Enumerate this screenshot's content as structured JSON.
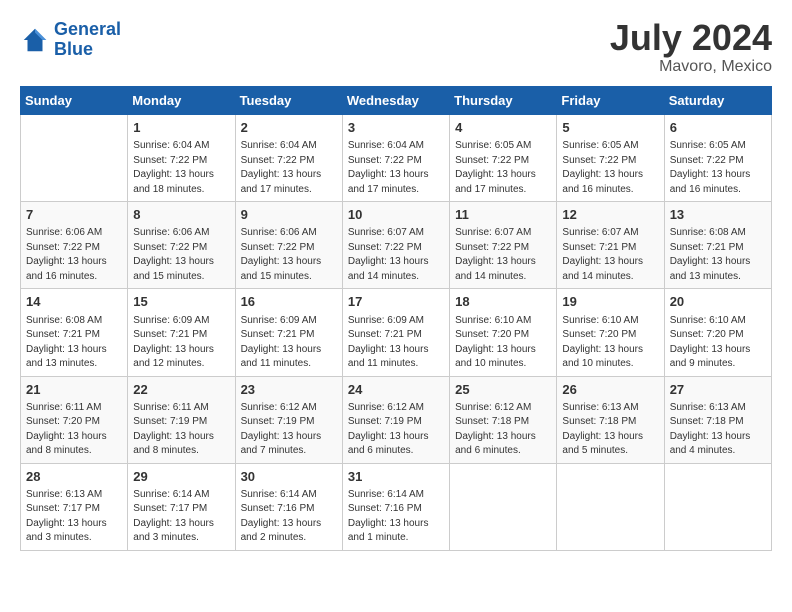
{
  "header": {
    "logo_line1": "General",
    "logo_line2": "Blue",
    "month_year": "July 2024",
    "location": "Mavoro, Mexico"
  },
  "columns": [
    "Sunday",
    "Monday",
    "Tuesday",
    "Wednesday",
    "Thursday",
    "Friday",
    "Saturday"
  ],
  "weeks": [
    [
      {
        "day": "",
        "sunrise": "",
        "sunset": "",
        "daylight": ""
      },
      {
        "day": "1",
        "sunrise": "Sunrise: 6:04 AM",
        "sunset": "Sunset: 7:22 PM",
        "daylight": "Daylight: 13 hours and 18 minutes."
      },
      {
        "day": "2",
        "sunrise": "Sunrise: 6:04 AM",
        "sunset": "Sunset: 7:22 PM",
        "daylight": "Daylight: 13 hours and 17 minutes."
      },
      {
        "day": "3",
        "sunrise": "Sunrise: 6:04 AM",
        "sunset": "Sunset: 7:22 PM",
        "daylight": "Daylight: 13 hours and 17 minutes."
      },
      {
        "day": "4",
        "sunrise": "Sunrise: 6:05 AM",
        "sunset": "Sunset: 7:22 PM",
        "daylight": "Daylight: 13 hours and 17 minutes."
      },
      {
        "day": "5",
        "sunrise": "Sunrise: 6:05 AM",
        "sunset": "Sunset: 7:22 PM",
        "daylight": "Daylight: 13 hours and 16 minutes."
      },
      {
        "day": "6",
        "sunrise": "Sunrise: 6:05 AM",
        "sunset": "Sunset: 7:22 PM",
        "daylight": "Daylight: 13 hours and 16 minutes."
      }
    ],
    [
      {
        "day": "7",
        "sunrise": "Sunrise: 6:06 AM",
        "sunset": "Sunset: 7:22 PM",
        "daylight": "Daylight: 13 hours and 16 minutes."
      },
      {
        "day": "8",
        "sunrise": "Sunrise: 6:06 AM",
        "sunset": "Sunset: 7:22 PM",
        "daylight": "Daylight: 13 hours and 15 minutes."
      },
      {
        "day": "9",
        "sunrise": "Sunrise: 6:06 AM",
        "sunset": "Sunset: 7:22 PM",
        "daylight": "Daylight: 13 hours and 15 minutes."
      },
      {
        "day": "10",
        "sunrise": "Sunrise: 6:07 AM",
        "sunset": "Sunset: 7:22 PM",
        "daylight": "Daylight: 13 hours and 14 minutes."
      },
      {
        "day": "11",
        "sunrise": "Sunrise: 6:07 AM",
        "sunset": "Sunset: 7:22 PM",
        "daylight": "Daylight: 13 hours and 14 minutes."
      },
      {
        "day": "12",
        "sunrise": "Sunrise: 6:07 AM",
        "sunset": "Sunset: 7:21 PM",
        "daylight": "Daylight: 13 hours and 14 minutes."
      },
      {
        "day": "13",
        "sunrise": "Sunrise: 6:08 AM",
        "sunset": "Sunset: 7:21 PM",
        "daylight": "Daylight: 13 hours and 13 minutes."
      }
    ],
    [
      {
        "day": "14",
        "sunrise": "Sunrise: 6:08 AM",
        "sunset": "Sunset: 7:21 PM",
        "daylight": "Daylight: 13 hours and 13 minutes."
      },
      {
        "day": "15",
        "sunrise": "Sunrise: 6:09 AM",
        "sunset": "Sunset: 7:21 PM",
        "daylight": "Daylight: 13 hours and 12 minutes."
      },
      {
        "day": "16",
        "sunrise": "Sunrise: 6:09 AM",
        "sunset": "Sunset: 7:21 PM",
        "daylight": "Daylight: 13 hours and 11 minutes."
      },
      {
        "day": "17",
        "sunrise": "Sunrise: 6:09 AM",
        "sunset": "Sunset: 7:21 PM",
        "daylight": "Daylight: 13 hours and 11 minutes."
      },
      {
        "day": "18",
        "sunrise": "Sunrise: 6:10 AM",
        "sunset": "Sunset: 7:20 PM",
        "daylight": "Daylight: 13 hours and 10 minutes."
      },
      {
        "day": "19",
        "sunrise": "Sunrise: 6:10 AM",
        "sunset": "Sunset: 7:20 PM",
        "daylight": "Daylight: 13 hours and 10 minutes."
      },
      {
        "day": "20",
        "sunrise": "Sunrise: 6:10 AM",
        "sunset": "Sunset: 7:20 PM",
        "daylight": "Daylight: 13 hours and 9 minutes."
      }
    ],
    [
      {
        "day": "21",
        "sunrise": "Sunrise: 6:11 AM",
        "sunset": "Sunset: 7:20 PM",
        "daylight": "Daylight: 13 hours and 8 minutes."
      },
      {
        "day": "22",
        "sunrise": "Sunrise: 6:11 AM",
        "sunset": "Sunset: 7:19 PM",
        "daylight": "Daylight: 13 hours and 8 minutes."
      },
      {
        "day": "23",
        "sunrise": "Sunrise: 6:12 AM",
        "sunset": "Sunset: 7:19 PM",
        "daylight": "Daylight: 13 hours and 7 minutes."
      },
      {
        "day": "24",
        "sunrise": "Sunrise: 6:12 AM",
        "sunset": "Sunset: 7:19 PM",
        "daylight": "Daylight: 13 hours and 6 minutes."
      },
      {
        "day": "25",
        "sunrise": "Sunrise: 6:12 AM",
        "sunset": "Sunset: 7:18 PM",
        "daylight": "Daylight: 13 hours and 6 minutes."
      },
      {
        "day": "26",
        "sunrise": "Sunrise: 6:13 AM",
        "sunset": "Sunset: 7:18 PM",
        "daylight": "Daylight: 13 hours and 5 minutes."
      },
      {
        "day": "27",
        "sunrise": "Sunrise: 6:13 AM",
        "sunset": "Sunset: 7:18 PM",
        "daylight": "Daylight: 13 hours and 4 minutes."
      }
    ],
    [
      {
        "day": "28",
        "sunrise": "Sunrise: 6:13 AM",
        "sunset": "Sunset: 7:17 PM",
        "daylight": "Daylight: 13 hours and 3 minutes."
      },
      {
        "day": "29",
        "sunrise": "Sunrise: 6:14 AM",
        "sunset": "Sunset: 7:17 PM",
        "daylight": "Daylight: 13 hours and 3 minutes."
      },
      {
        "day": "30",
        "sunrise": "Sunrise: 6:14 AM",
        "sunset": "Sunset: 7:16 PM",
        "daylight": "Daylight: 13 hours and 2 minutes."
      },
      {
        "day": "31",
        "sunrise": "Sunrise: 6:14 AM",
        "sunset": "Sunset: 7:16 PM",
        "daylight": "Daylight: 13 hours and 1 minute."
      },
      {
        "day": "",
        "sunrise": "",
        "sunset": "",
        "daylight": ""
      },
      {
        "day": "",
        "sunrise": "",
        "sunset": "",
        "daylight": ""
      },
      {
        "day": "",
        "sunrise": "",
        "sunset": "",
        "daylight": ""
      }
    ]
  ]
}
